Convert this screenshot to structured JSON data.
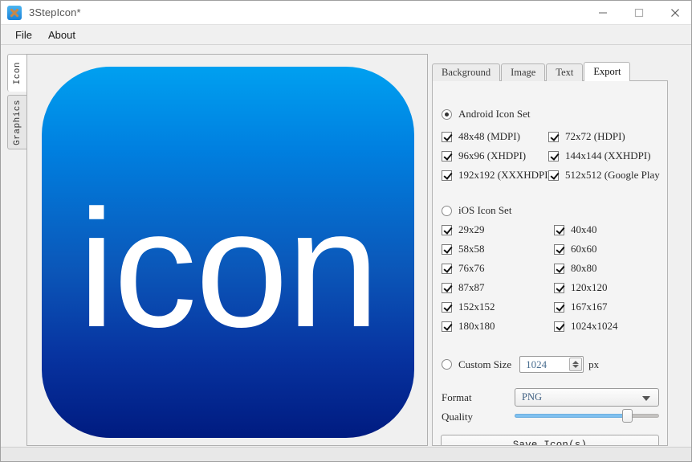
{
  "window": {
    "title": "3StepIcon*",
    "app_icon": "crossed-tools-icon",
    "minimize_label": "minimize-icon",
    "maximize_label": "maximize-icon",
    "close_label": "close-icon"
  },
  "menubar": {
    "items": [
      {
        "label": "File"
      },
      {
        "label": "About"
      }
    ]
  },
  "vertical_tabs": [
    {
      "label": "Icon",
      "active": true
    },
    {
      "label": "Graphics",
      "active": false
    }
  ],
  "preview": {
    "icon_text": "icon",
    "gradient_top": "#00a0f0",
    "gradient_bottom": "#001b80"
  },
  "tabs": [
    {
      "label": "Background",
      "active": false
    },
    {
      "label": "Image",
      "active": false
    },
    {
      "label": "Text",
      "active": false
    },
    {
      "label": "Export",
      "active": true
    }
  ],
  "export": {
    "android": {
      "group_label": "Android Icon Set",
      "selected": true,
      "sizes": [
        {
          "label": "48x48  (MDPI)",
          "checked": true
        },
        {
          "label": "72x72  (HDPI)",
          "checked": true
        },
        {
          "label": "96x96  (XHDPI)",
          "checked": true
        },
        {
          "label": "144x144  (XXHDPI)",
          "checked": true
        },
        {
          "label": "192x192  (XXXHDPI)",
          "checked": true
        },
        {
          "label": "512x512  (Google Play",
          "checked": true
        }
      ]
    },
    "ios": {
      "group_label": "iOS Icon Set",
      "selected": false,
      "sizes": [
        {
          "label": "29x29",
          "checked": true
        },
        {
          "label": "40x40",
          "checked": true
        },
        {
          "label": "58x58",
          "checked": true
        },
        {
          "label": "60x60",
          "checked": true
        },
        {
          "label": "76x76",
          "checked": true
        },
        {
          "label": "80x80",
          "checked": true
        },
        {
          "label": "87x87",
          "checked": true
        },
        {
          "label": "120x120",
          "checked": true
        },
        {
          "label": "152x152",
          "checked": true
        },
        {
          "label": "167x167",
          "checked": true
        },
        {
          "label": "180x180",
          "checked": true
        },
        {
          "label": "1024x1024",
          "checked": true
        }
      ]
    },
    "custom": {
      "label": "Custom Size",
      "selected": false,
      "value": "1024",
      "unit": "px"
    },
    "format": {
      "label": "Format",
      "value": "PNG"
    },
    "quality": {
      "label": "Quality",
      "percent": 78
    },
    "save_button": "Save Icon(s)"
  }
}
